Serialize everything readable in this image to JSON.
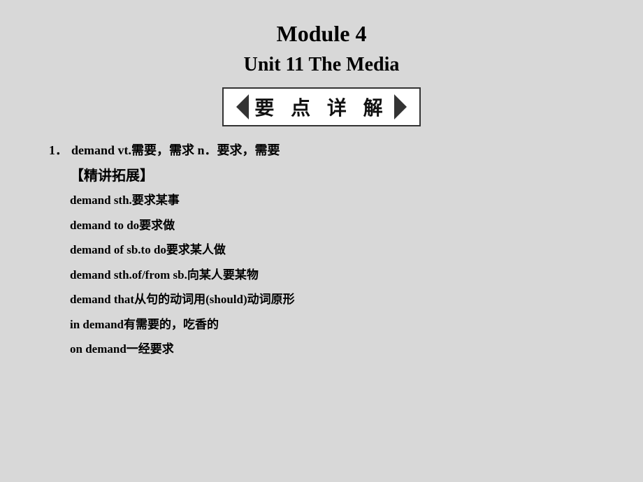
{
  "page": {
    "background_color": "#d8d8d8"
  },
  "header": {
    "module_title": "Module 4",
    "unit_title": "Unit 11    The Media"
  },
  "banner": {
    "text": "要 点 详 解"
  },
  "content": {
    "item1": {
      "number": "1．",
      "main_text": "demand vt.需要，需求  n．要求，需要",
      "jing_jiang": "【精讲拓展】",
      "sub_items": [
        "demand sth.要求某事",
        "demand to do要求做",
        "demand of sb.to do要求某人做",
        "demand sth.of/from sb.向某人要某物",
        "demand that从句的动词用(should)动词原形",
        "in demand有需要的，吃香的",
        "on demand一经要求"
      ]
    }
  }
}
